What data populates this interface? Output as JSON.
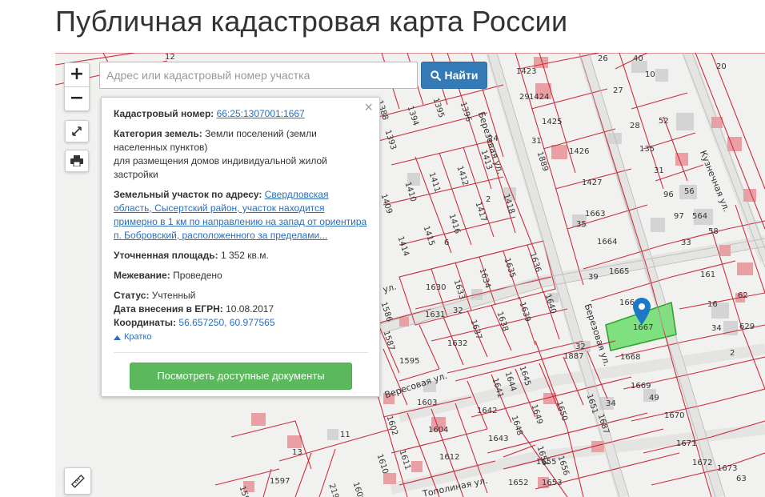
{
  "page": {
    "title": "Публичная кадастровая карта России"
  },
  "search": {
    "placeholder": "Адрес или кадастровый номер участка",
    "button_label": "Найти"
  },
  "controls": {
    "zoom_in": "+",
    "zoom_out": "−"
  },
  "info": {
    "cad_num_label": "Кадастровый номер:",
    "cad_num_value": "66:25:1307001:1667",
    "category_label": "Категория земель:",
    "category_value": "Земли поселений (земли населенных пунктов)",
    "usage_value": "для размещения домов индивидуальной жилой застройки",
    "address_label": "Земельный участок по адресу:",
    "address_value": "Свердловская область, Сысертский район, участок находится примерно в 1 км по направлению на запад от ориентира п. Бобровский, расположенного за пределами...",
    "area_label": "Уточненная площадь:",
    "area_value": "1 352 кв.м.",
    "survey_label": "Межевание:",
    "survey_value": "Проведено",
    "status_label": "Статус:",
    "status_value": "Учтенный",
    "date_label": "Дата внесения в ЕГРН:",
    "date_value": "10.08.2017",
    "coords_label": "Координаты:",
    "coords_value": "56.657250, 60.977565",
    "brief_label": "Кратко",
    "docs_button": "Посмотреть доступные документы",
    "close": "×"
  },
  "streets": {
    "berezovaya_top": "Березовая ул.",
    "berezovaya_mid": "Березовая ул.",
    "kuznechnaya": "Кузнечная ул.",
    "veresovaya": "Вересовая ул.",
    "topolinaya": "Тополиная ул.",
    "u1": "ул."
  },
  "parcel_labels": [
    {
      "t": "12"
    },
    {
      "t": "26"
    },
    {
      "t": "40"
    },
    {
      "t": "20"
    },
    {
      "t": "1423"
    },
    {
      "t": "1396"
    },
    {
      "t": "1395"
    },
    {
      "t": "1394"
    },
    {
      "t": "1388"
    },
    {
      "t": "1393"
    },
    {
      "t": "29"
    },
    {
      "t": "1424"
    },
    {
      "t": "1425"
    },
    {
      "t": "27"
    },
    {
      "t": "10"
    },
    {
      "t": "31"
    },
    {
      "t": "28"
    },
    {
      "t": "52"
    },
    {
      "t": "1426"
    },
    {
      "t": "1889"
    },
    {
      "t": "135"
    },
    {
      "t": "31"
    },
    {
      "t": "1427"
    },
    {
      "t": "96"
    },
    {
      "t": "56"
    },
    {
      "t": "24"
    },
    {
      "t": "1413"
    },
    {
      "t": "1412"
    },
    {
      "t": "1411"
    },
    {
      "t": "1410"
    },
    {
      "t": "1409"
    },
    {
      "t": "2"
    },
    {
      "t": "1417"
    },
    {
      "t": "1418"
    },
    {
      "t": "1416"
    },
    {
      "t": "1415"
    },
    {
      "t": "1414"
    },
    {
      "t": "6"
    },
    {
      "t": "1663"
    },
    {
      "t": "35"
    },
    {
      "t": "97"
    },
    {
      "t": "564"
    },
    {
      "t": "58"
    },
    {
      "t": "33"
    },
    {
      "t": "1664"
    },
    {
      "t": "1635"
    },
    {
      "t": "1636"
    },
    {
      "t": "1634"
    },
    {
      "t": "1633"
    },
    {
      "t": "1630"
    },
    {
      "t": "32"
    },
    {
      "t": "1665"
    },
    {
      "t": "39"
    },
    {
      "t": "161"
    },
    {
      "t": "1639"
    },
    {
      "t": "1640"
    },
    {
      "t": "1638"
    },
    {
      "t": "1637"
    },
    {
      "t": "1631"
    },
    {
      "t": "1586"
    },
    {
      "t": "1666"
    },
    {
      "t": "16"
    },
    {
      "t": "62"
    },
    {
      "t": "1667"
    },
    {
      "t": "34"
    },
    {
      "t": "629"
    },
    {
      "t": "1632"
    },
    {
      "t": "1887"
    },
    {
      "t": "32"
    },
    {
      "t": "1587"
    },
    {
      "t": "1668"
    },
    {
      "t": "2"
    },
    {
      "t": "1595"
    },
    {
      "t": "1645"
    },
    {
      "t": "1641"
    },
    {
      "t": "1644"
    },
    {
      "t": "1669"
    },
    {
      "t": "49"
    },
    {
      "t": "1603"
    },
    {
      "t": "1642"
    },
    {
      "t": "1649"
    },
    {
      "t": "1650"
    },
    {
      "t": "1651"
    },
    {
      "t": "34"
    },
    {
      "t": "1670"
    },
    {
      "t": "1602"
    },
    {
      "t": "1604"
    },
    {
      "t": "1648"
    },
    {
      "t": "1687"
    },
    {
      "t": "1643"
    },
    {
      "t": "11"
    },
    {
      "t": "1671"
    },
    {
      "t": "13"
    },
    {
      "t": "1610"
    },
    {
      "t": "1611"
    },
    {
      "t": "1612"
    },
    {
      "t": "1655"
    },
    {
      "t": "1656"
    },
    {
      "t": "1654"
    },
    {
      "t": "1672"
    },
    {
      "t": "1597"
    },
    {
      "t": "1596"
    },
    {
      "t": "219"
    },
    {
      "t": "1609"
    },
    {
      "t": "1652"
    },
    {
      "t": "1653"
    },
    {
      "t": "1673"
    },
    {
      "t": "63"
    }
  ]
}
